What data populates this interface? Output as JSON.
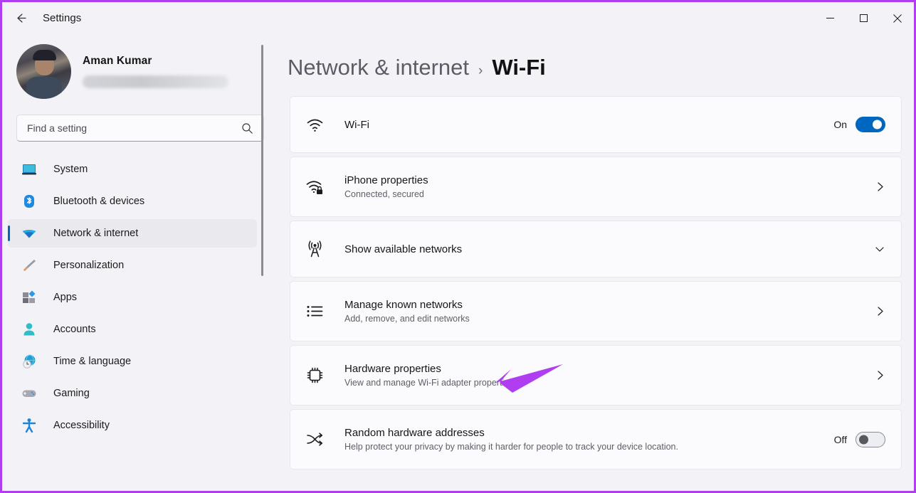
{
  "window": {
    "title": "Settings",
    "back_icon": "back-arrow-icon",
    "controls": {
      "minimize": "minimize-icon",
      "maximize": "maximize-icon",
      "close": "close-icon"
    }
  },
  "accent_color": "#0067c0",
  "annotation_color": "#b13df0",
  "sidebar": {
    "profile": {
      "name": "Aman Kumar",
      "email_redacted": true
    },
    "search": {
      "placeholder": "Find a setting",
      "value": "",
      "icon": "search-icon"
    },
    "items": [
      {
        "label": "System",
        "icon": "system-icon",
        "active": false
      },
      {
        "label": "Bluetooth & devices",
        "icon": "bluetooth-icon",
        "active": false
      },
      {
        "label": "Network & internet",
        "icon": "network-icon",
        "active": true
      },
      {
        "label": "Personalization",
        "icon": "paintbrush-icon",
        "active": false
      },
      {
        "label": "Apps",
        "icon": "apps-icon",
        "active": false
      },
      {
        "label": "Accounts",
        "icon": "account-icon",
        "active": false
      },
      {
        "label": "Time & language",
        "icon": "clock-globe-icon",
        "active": false
      },
      {
        "label": "Gaming",
        "icon": "gamepad-icon",
        "active": false
      },
      {
        "label": "Accessibility",
        "icon": "accessibility-icon",
        "active": false
      }
    ]
  },
  "main": {
    "breadcrumb": {
      "parent": "Network & internet",
      "separator": "›",
      "current": "Wi-Fi"
    },
    "cards": [
      {
        "title": "Wi-Fi",
        "subtitle": "",
        "icon": "wifi-icon",
        "control": "toggle",
        "state_label": "On",
        "state_on": true
      },
      {
        "title": "iPhone properties",
        "subtitle": "Connected, secured",
        "icon": "wifi-lock-icon",
        "control": "chevron-right",
        "state_label": "",
        "state_on": false
      },
      {
        "title": "Show available networks",
        "subtitle": "",
        "icon": "broadcast-tower-icon",
        "control": "chevron-down",
        "state_label": "",
        "state_on": false
      },
      {
        "title": "Manage known networks",
        "subtitle": "Add, remove, and edit networks",
        "icon": "list-icon",
        "control": "chevron-right",
        "state_label": "",
        "state_on": false
      },
      {
        "title": "Hardware properties",
        "subtitle": "View and manage Wi-Fi adapter properties",
        "icon": "chip-icon",
        "control": "chevron-right",
        "state_label": "",
        "state_on": false
      },
      {
        "title": "Random hardware addresses",
        "subtitle": "Help protect your privacy by making it harder for people to track your device location.",
        "icon": "shuffle-icon",
        "control": "toggle",
        "state_label": "Off",
        "state_on": false
      }
    ]
  },
  "annotation": {
    "type": "arrow",
    "points_to": "Hardware properties",
    "color": "#b13df0"
  }
}
